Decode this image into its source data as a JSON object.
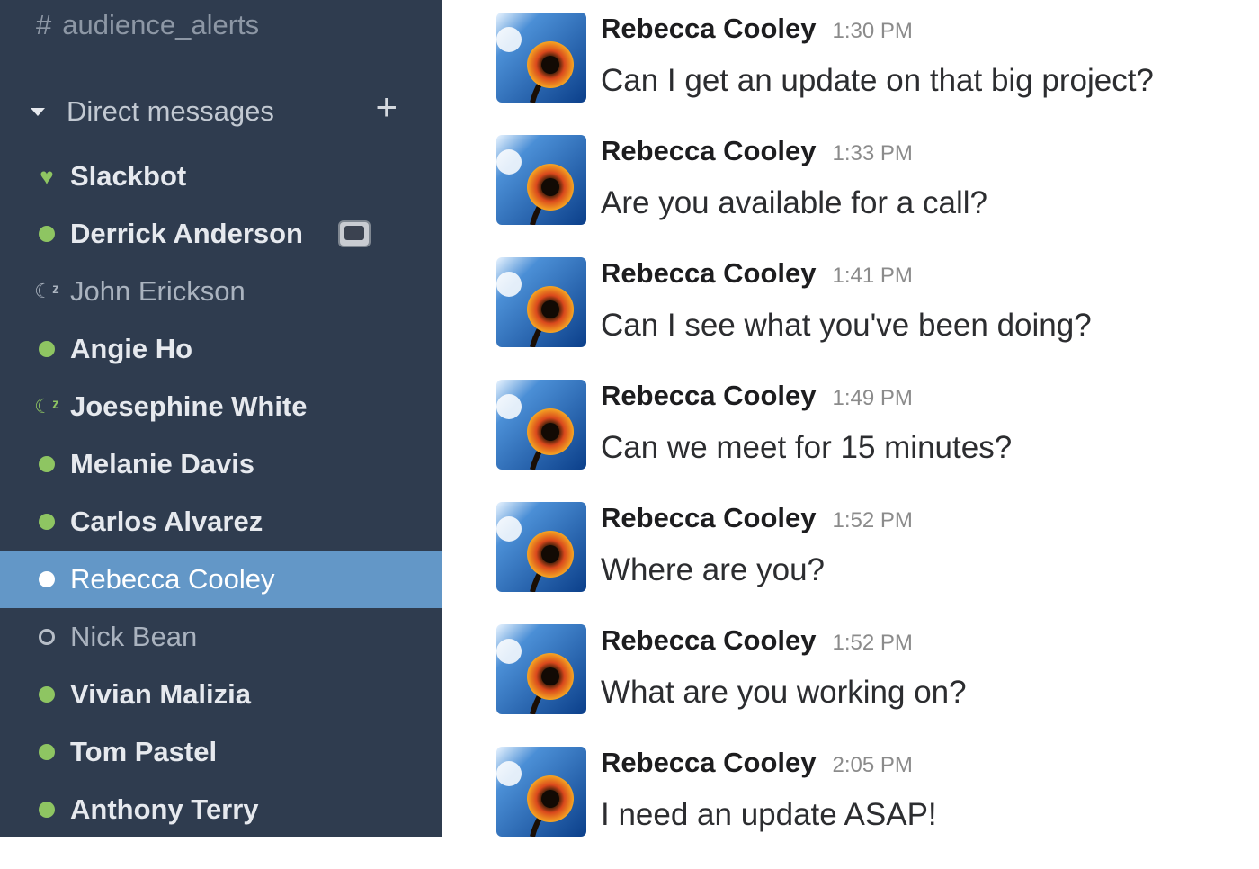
{
  "sidebar": {
    "channel": {
      "hash": "#",
      "name": "audience_alerts"
    },
    "dm_header": {
      "title": "Direct messages",
      "add": "+"
    },
    "dms": [
      {
        "name": "Slackbot",
        "status": "heart"
      },
      {
        "name": "Derrick Anderson",
        "status": "online",
        "extra_icon": "tv-icon"
      },
      {
        "name": "John Erickson",
        "status": "snooze-away"
      },
      {
        "name": "Angie Ho",
        "status": "online"
      },
      {
        "name": "Joesephine White",
        "status": "snooze-online"
      },
      {
        "name": "Melanie Davis",
        "status": "online"
      },
      {
        "name": "Carlos Alvarez",
        "status": "online"
      },
      {
        "name": "Rebecca Cooley",
        "status": "active-selected"
      },
      {
        "name": "Nick Bean",
        "status": "away"
      },
      {
        "name": "Vivian Malizia",
        "status": "online"
      },
      {
        "name": "Tom Pastel",
        "status": "online"
      },
      {
        "name": "Anthony Terry",
        "status": "online"
      }
    ]
  },
  "messages": [
    {
      "author": "Rebecca Cooley",
      "time": "1:30 PM",
      "text": "Can I get an update on that big project?"
    },
    {
      "author": "Rebecca Cooley",
      "time": "1:33 PM",
      "text": "Are you available for a call?"
    },
    {
      "author": "Rebecca Cooley",
      "time": "1:41 PM",
      "text": "Can I see what you've been doing?"
    },
    {
      "author": "Rebecca Cooley",
      "time": "1:49 PM",
      "text": "Can we meet for 15 minutes?"
    },
    {
      "author": "Rebecca Cooley",
      "time": "1:52 PM",
      "text": "Where are you?"
    },
    {
      "author": "Rebecca Cooley",
      "time": "1:52 PM",
      "text": "What are you working on?"
    },
    {
      "author": "Rebecca Cooley",
      "time": "2:05 PM",
      "text": "I need an update ASAP!"
    }
  ],
  "colors": {
    "sidebar_bg": "#2f3c4f",
    "selected_bg": "#6397c7",
    "online": "#8ec562"
  }
}
